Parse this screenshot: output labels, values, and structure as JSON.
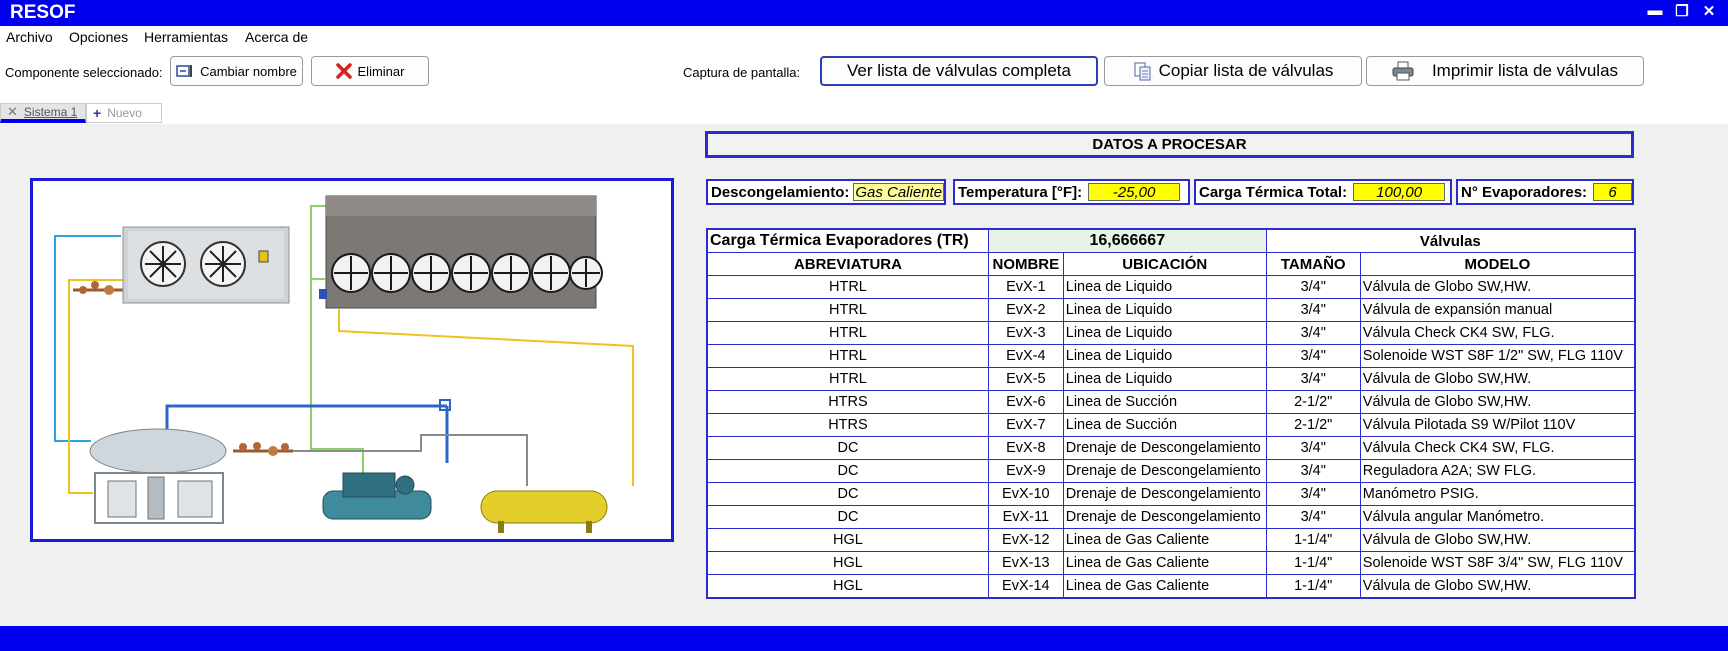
{
  "app": {
    "title": "RESOF"
  },
  "window_controls": {
    "minimize": "▬",
    "maximize": "❐",
    "close": "✕"
  },
  "menu": [
    "Archivo",
    "Opciones",
    "Herramientas",
    "Acerca de"
  ],
  "toolbar": {
    "selected_label": "Componente seleccionado:",
    "rename_label": "Cambiar nombre",
    "delete_label": "Eliminar",
    "screenshot_label": "Captura de pantalla:",
    "view_full_list": "Ver lista de válvulas completa",
    "copy_list": "Copiar lista de válvulas",
    "print_list": "Imprimir lista de válvulas"
  },
  "tabs": {
    "active": "Sistema 1",
    "new": "Nuevo"
  },
  "panel": {
    "title": "DATOS A PROCESAR",
    "defrost_label": "Descongelamiento:",
    "defrost_value": "Gas Caliente",
    "temp_label": "Temperatura [°F]:",
    "temp_value": "-25,00",
    "load_label": "Carga Térmica Total:",
    "load_value": "100,00",
    "evap_label": "N° Evaporadores:",
    "evap_value": "6"
  },
  "table": {
    "load_label": "Carga Térmica Evaporadores (TR)",
    "load_value": "16,666667",
    "valves_label": "Válvulas",
    "headers": [
      "ABREVIATURA",
      "NOMBRE",
      "UBICACIÓN",
      "TAMAÑO",
      "MODELO"
    ],
    "rows": [
      [
        "HTRL",
        "EvX-1",
        "Linea de Liquido",
        "3/4\"",
        "Válvula de Globo SW,HW."
      ],
      [
        "HTRL",
        "EvX-2",
        "Linea de Liquido",
        "3/4\"",
        "Válvula de expansión manual"
      ],
      [
        "HTRL",
        "EvX-3",
        "Linea de Liquido",
        "3/4\"",
        "Válvula Check CK4 SW, FLG."
      ],
      [
        "HTRL",
        "EvX-4",
        "Linea de Liquido",
        "3/4\"",
        "Solenoide WST S8F 1/2\" SW, FLG 110V"
      ],
      [
        "HTRL",
        "EvX-5",
        "Linea de Liquido",
        "3/4\"",
        "Válvula de Globo SW,HW."
      ],
      [
        "HTRS",
        "EvX-6",
        "Linea de Succión",
        "2-1/2\"",
        "Válvula de Globo SW,HW."
      ],
      [
        "HTRS",
        "EvX-7",
        "Linea de Succión",
        "2-1/2\"",
        "Válvula Pilotada S9 W/Pilot 110V"
      ],
      [
        "DC",
        "EvX-8",
        "Drenaje de Descongelamiento",
        "3/4\"",
        "Válvula Check CK4 SW, FLG."
      ],
      [
        "DC",
        "EvX-9",
        "Drenaje de Descongelamiento",
        "3/4\"",
        "Reguladora A2A; SW FLG."
      ],
      [
        "DC",
        "EvX-10",
        "Drenaje de Descongelamiento",
        "3/4\"",
        "Manómetro  PSIG."
      ],
      [
        "DC",
        "EvX-11",
        "Drenaje de Descongelamiento",
        "3/4\"",
        "Válvula angular Manómetro."
      ],
      [
        "HGL",
        "EvX-12",
        "Linea de Gas Caliente",
        "1-1/4\"",
        "Válvula de Globo SW,HW."
      ],
      [
        "HGL",
        "EvX-13",
        "Linea de Gas Caliente",
        "1-1/4\"",
        "Solenoide WST S8F 3/4\" SW, FLG 110V"
      ],
      [
        "HGL",
        "EvX-14",
        "Linea de Gas Caliente",
        "1-1/4\"",
        "Válvula de Globo SW,HW."
      ]
    ]
  },
  "colors": {
    "chrome_blue": "#0000ee",
    "grid_blue": "#2b2bd0",
    "highlight_yellow": "#ffff00",
    "load_cell": "#e6f3e6"
  }
}
